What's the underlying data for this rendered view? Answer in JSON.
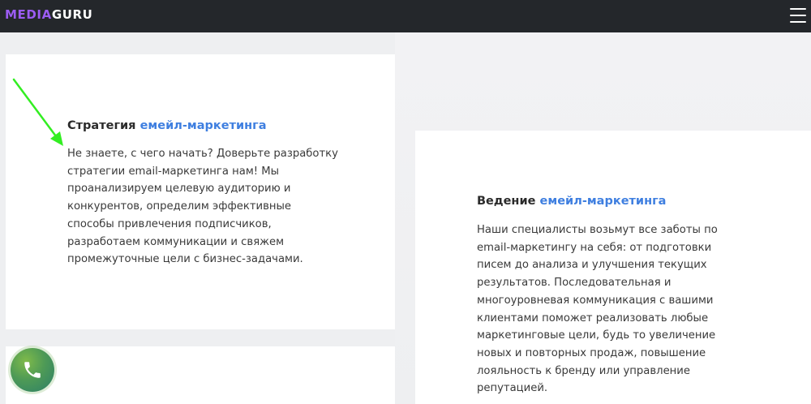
{
  "header": {
    "logo_prefix": "MEDIA",
    "logo_suffix": "GURU",
    "menu_icon": "hamburger-menu-icon"
  },
  "cards": [
    {
      "title_plain": "Стратегия",
      "title_accent": "емейл-маркетинга",
      "lines": [
        "Не знаете, с чего начать? Доверьте разработку",
        "стратегии email-маркетинга нам! Мы",
        "проанализируем целевую аудиторию и",
        "конкурентов, определим эффективные",
        "способы привлечения подписчиков,",
        "разработаем коммуникации и свяжем",
        "промежуточные цели с бизнес-задачами."
      ]
    },
    {
      "title_plain": "Ведение",
      "title_accent": "емейл-маркетинга",
      "lines": [
        "Наши специалисты возьмут все заботы по",
        "email-маркетингу на себя: от подготовки",
        "писем до анализа и улучшения текущих",
        "результатов. Последовательная и",
        "многоуровневая коммуникация с вашими",
        "клиентами поможет реализовать любые",
        "маркетинговые цели, будь то увеличение",
        "новых и повторных продаж, повышение",
        "лояльность к бренду или управление",
        "репутацией."
      ]
    }
  ],
  "annotation": {
    "arrow_color": "#33ee22",
    "icon": "arrow-annotation-icon"
  },
  "call_button": {
    "icon": "phone-icon"
  },
  "colors": {
    "header_bg": "#24272b",
    "logo_accent": "#9b5cf2",
    "title_accent": "#3f7fe0",
    "page_bg": "#eeeff1",
    "card_bg": "#ffffff"
  }
}
